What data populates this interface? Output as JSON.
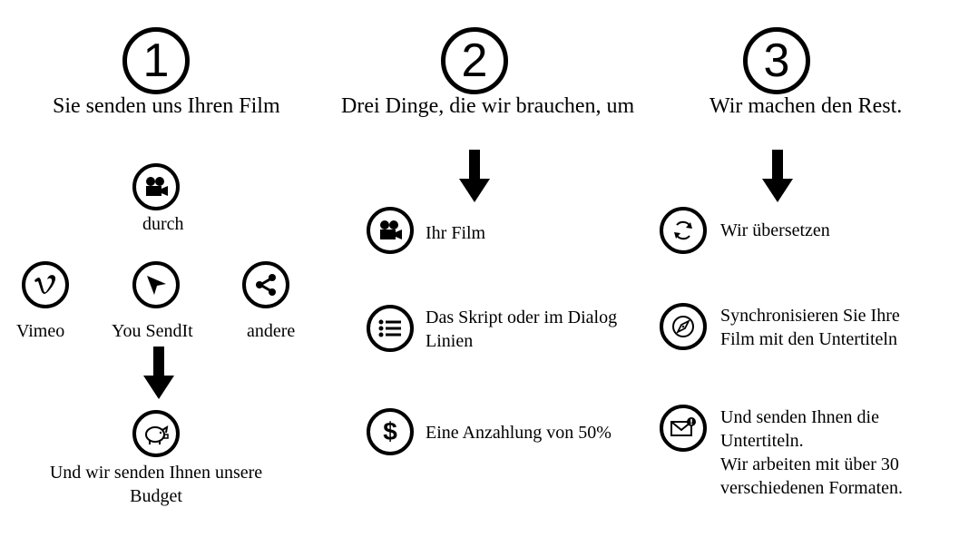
{
  "steps": [
    {
      "number": "1",
      "title": "Sie senden uns Ihren Film"
    },
    {
      "number": "2",
      "title": "Drei Dinge, die wir brauchen, um"
    },
    {
      "number": "3",
      "title": "Wir machen den Rest."
    }
  ],
  "col1": {
    "via_label": "durch",
    "channels": [
      "Vimeo",
      "You SendIt",
      "andere"
    ],
    "result_line1": "Und wir senden Ihnen unsere",
    "result_line2": "Budget"
  },
  "col2": {
    "items": [
      {
        "line1": "Ihr Film",
        "line2": ""
      },
      {
        "line1": "Das Skript oder im Dialog",
        "line2": "Linien"
      },
      {
        "line1": "Eine Anzahlung von 50%",
        "line2": ""
      }
    ]
  },
  "col3": {
    "items": [
      {
        "line1": "Wir übersetzen"
      },
      {
        "line1": "Synchronisieren Sie Ihre",
        "line2": "Film mit den Untertiteln"
      },
      {
        "line1": "Und senden Ihnen die",
        "line2": "Untertiteln.",
        "line3": "Wir arbeiten mit über 30",
        "line4": "verschiedenen Formaten."
      }
    ]
  },
  "icons": [
    "film-camera-icon",
    "vimeo-icon",
    "send-icon",
    "share-icon",
    "piggy-bank-icon",
    "list-icon",
    "dollar-icon",
    "refresh-icon",
    "compass-icon",
    "mail-alert-icon"
  ]
}
